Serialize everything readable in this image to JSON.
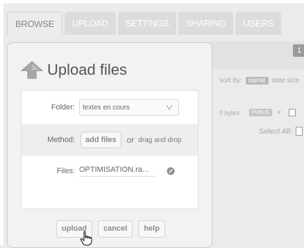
{
  "tabs": [
    {
      "label": "BROWSE",
      "active": true
    },
    {
      "label": "UPLOAD",
      "active": false
    },
    {
      "label": "SETTINGS",
      "active": false
    },
    {
      "label": "SHARING",
      "active": false
    },
    {
      "label": "USERS",
      "active": false
    }
  ],
  "background": {
    "page_number": "1",
    "sort_label": "sort by:",
    "sort_active": "name",
    "sort_date": "date",
    "sort_size": "size",
    "bytes": "0 bytes",
    "visibility_badge": "PUBLIC",
    "select_all": "Select All:"
  },
  "upload_panel": {
    "title": "Upload files",
    "folder_label": "Folder:",
    "folder_value": "textes en cours",
    "method_label": "Method:",
    "add_files_label": "add files",
    "or_label": "or",
    "drag_drop_label": "drag and drop",
    "files_label": "Files:",
    "file_name": "OPTIMISATION.ra...",
    "upload_label": "upload",
    "cancel_label": "cancel",
    "help_label": "help"
  },
  "icons": {
    "upload": "upload-arrow-icon",
    "dropdown": "chevron-down-icon",
    "remove": "remove-file-icon",
    "cursor": "hand-pointer-icon"
  },
  "colors": {
    "tab_inactive": "#dcdcdc",
    "tab_active": "#ececec",
    "upload_arrow": "#a7a7a7",
    "panel_bg": "#f2f2f2"
  }
}
